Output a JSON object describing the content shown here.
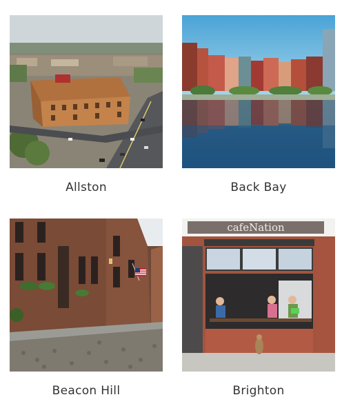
{
  "neighborhoods": [
    {
      "name": "Allston",
      "image": "aerial street view with brick buildings and traffic"
    },
    {
      "name": "Back Bay",
      "image": "brownstone rowhouses reflected in the Charles River"
    },
    {
      "name": "Beacon Hill",
      "image": "cobblestone street lined with brick rowhouses and an American flag"
    },
    {
      "name": "Brighton",
      "image": "cafe storefront with people seated at the window"
    }
  ],
  "brighton_sign": "cafeNation"
}
